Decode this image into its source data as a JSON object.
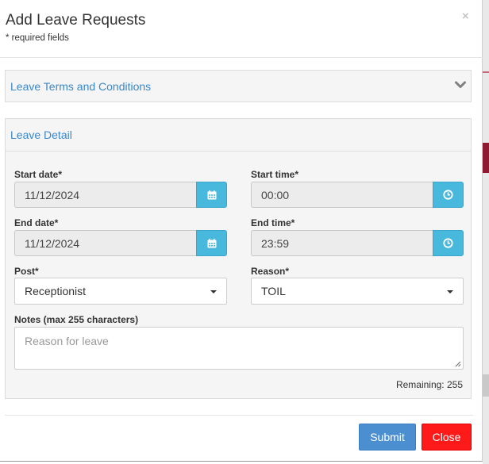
{
  "modal": {
    "title": "Add Leave Requests",
    "subtitle": "* required fields",
    "close_glyph": "×"
  },
  "terms_panel": {
    "title": "Leave Terms and Conditions",
    "icon": "chevron-down-icon"
  },
  "detail_panel": {
    "title": "Leave Detail",
    "start_date": {
      "label": "Start date*",
      "value": "11/12/2024",
      "icon": "calendar-icon"
    },
    "start_time": {
      "label": "Start time*",
      "value": "00:00",
      "icon": "clock-icon"
    },
    "end_date": {
      "label": "End date*",
      "value": "11/12/2024",
      "icon": "calendar-icon"
    },
    "end_time": {
      "label": "End time*",
      "value": "23:59",
      "icon": "clock-icon"
    },
    "post": {
      "label": "Post*",
      "value": "Receptionist"
    },
    "reason": {
      "label": "Reason*",
      "value": "TOIL"
    },
    "notes": {
      "label": "Notes (max 255 characters)",
      "placeholder": "Reason for leave"
    },
    "remaining": "Remaining: 255"
  },
  "footer": {
    "submit_label": "Submit",
    "close_label": "Close"
  },
  "colors": {
    "accent": "#49b8dd",
    "link": "#3a87c8",
    "submit": "#4c8fd0",
    "close": "#ff1a1a"
  }
}
